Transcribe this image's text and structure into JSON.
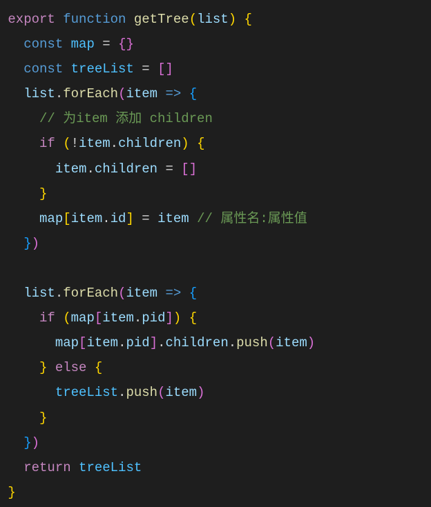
{
  "code": {
    "l1": {
      "export": "export",
      "function": "function",
      "fnName": "getTree",
      "paren1": "(",
      "param": "list",
      "paren2": ")",
      "sp": " ",
      "brace": "{"
    },
    "l2": {
      "indent": "  ",
      "const": "const",
      "sp1": " ",
      "var": "map",
      "sp2": " ",
      "eq": "=",
      "sp3": " ",
      "b1": "{",
      "b2": "}"
    },
    "l3": {
      "indent": "  ",
      "const": "const",
      "sp1": " ",
      "var": "treeList",
      "sp2": " ",
      "eq": "=",
      "sp3": " ",
      "b1": "[",
      "b2": "]"
    },
    "l4": {
      "indent": "  ",
      "var": "list",
      "dot": ".",
      "method": "forEach",
      "p1": "(",
      "param": "item",
      "sp1": " ",
      "arrow": "=>",
      "sp2": " ",
      "brace": "{"
    },
    "l5": {
      "indent": "    ",
      "comment": "// 为item 添加 children"
    },
    "l6": {
      "indent": "    ",
      "if": "if",
      "sp1": " ",
      "p1": "(",
      "bang": "!",
      "var": "item",
      "dot": ".",
      "prop": "children",
      "p2": ")",
      "sp2": " ",
      "brace": "{"
    },
    "l7": {
      "indent": "      ",
      "var": "item",
      "dot": ".",
      "prop": "children",
      "sp1": " ",
      "eq": "=",
      "sp2": " ",
      "b1": "[",
      "b2": "]"
    },
    "l8": {
      "indent": "    ",
      "brace": "}"
    },
    "l9": {
      "indent": "    ",
      "var": "map",
      "b1": "[",
      "var2": "item",
      "dot": ".",
      "prop": "id",
      "b2": "]",
      "sp1": " ",
      "eq": "=",
      "sp2": " ",
      "var3": "item",
      "sp3": " ",
      "comment": "// 属性名:属性值"
    },
    "l10": {
      "indent": "  ",
      "brace": "}",
      "p2": ")"
    },
    "l11": {
      "blank": ""
    },
    "l12": {
      "indent": "  ",
      "var": "list",
      "dot": ".",
      "method": "forEach",
      "p1": "(",
      "param": "item",
      "sp1": " ",
      "arrow": "=>",
      "sp2": " ",
      "brace": "{"
    },
    "l13": {
      "indent": "    ",
      "if": "if",
      "sp1": " ",
      "p1": "(",
      "var": "map",
      "b1": "[",
      "var2": "item",
      "dot": ".",
      "prop": "pid",
      "b2": "]",
      "p2": ")",
      "sp2": " ",
      "brace": "{"
    },
    "l14": {
      "indent": "      ",
      "var": "map",
      "b1": "[",
      "var2": "item",
      "dot": ".",
      "prop": "pid",
      "b2": "]",
      "dot2": ".",
      "prop2": "children",
      "dot3": ".",
      "method": "push",
      "p1": "(",
      "var3": "item",
      "p2": ")"
    },
    "l15": {
      "indent": "    ",
      "brace": "}",
      "sp": " ",
      "else": "else",
      "sp2": " ",
      "brace2": "{"
    },
    "l16": {
      "indent": "      ",
      "var": "treeList",
      "dot": ".",
      "method": "push",
      "p1": "(",
      "var2": "item",
      "p2": ")"
    },
    "l17": {
      "indent": "    ",
      "brace": "}"
    },
    "l18": {
      "indent": "  ",
      "brace": "}",
      "p2": ")"
    },
    "l19": {
      "indent": "  ",
      "return": "return",
      "sp": " ",
      "var": "treeList"
    },
    "l20": {
      "brace": "}"
    }
  }
}
